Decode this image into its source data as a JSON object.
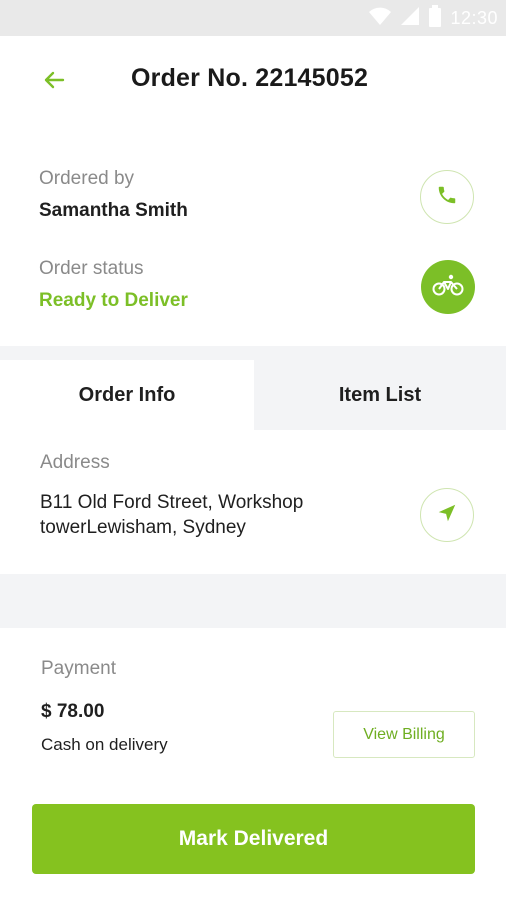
{
  "status_bar": {
    "time": "12:30"
  },
  "header": {
    "title": "Order No. 22145052"
  },
  "customer": {
    "label": "Ordered by",
    "name": "Samantha Smith"
  },
  "order_status": {
    "label": "Order status",
    "value": "Ready to Deliver"
  },
  "tabs": [
    {
      "label": "Order Info",
      "active": true
    },
    {
      "label": "Item List",
      "active": false
    }
  ],
  "address": {
    "label": "Address",
    "value": "B11 Old Ford Street, Workshop towerLewisham, Sydney"
  },
  "payment": {
    "label": "Payment",
    "amount": "$ 78.00",
    "method": "Cash on delivery",
    "billing_button": "View Billing"
  },
  "actions": {
    "primary": "Mark Delivered"
  },
  "colors": {
    "accent": "#7cbf27",
    "button": "#85c21f",
    "panel": "#f3f4f6"
  },
  "icons": [
    "back-arrow-icon",
    "phone-icon",
    "bicycle-icon",
    "navigation-arrow-icon",
    "wifi-icon",
    "signal-icon",
    "battery-icon"
  ]
}
